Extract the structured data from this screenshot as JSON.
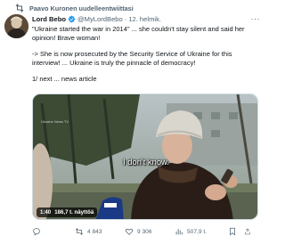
{
  "repost_banner": {
    "icon": "repost-icon",
    "text": "Paavo Kuronen uudelleentwiittasi"
  },
  "tweet": {
    "author_name": "Lord Bebo",
    "verified": true,
    "handle": "@MyLordBebo",
    "separator": "·",
    "date": "12. helmik.",
    "more_label": "···",
    "text": {
      "p1": "\"Ukraine started the war in 2014\" ... she couldn't stay silent and said her opinion! Brave woman!",
      "p2": "-> She is now prosecuted by the Security Service of Ukraine for this interview! ... Ukraine is truly the pinnacle of democracy!",
      "p3": "1/ next ... news article"
    }
  },
  "video": {
    "watermark": "Ukraine News TV",
    "subtitle": "I don't know.",
    "duration": "1:40",
    "views": "186,7 t. näyttöä"
  },
  "actions": {
    "reply_count": "",
    "repost_count": "4 843",
    "like_count": "9 306",
    "view_count": "507,9 t."
  },
  "colors": {
    "text": "#0f1419",
    "secondary": "#536471",
    "verified": "#1d9bf0",
    "border": "#cfd9de"
  }
}
